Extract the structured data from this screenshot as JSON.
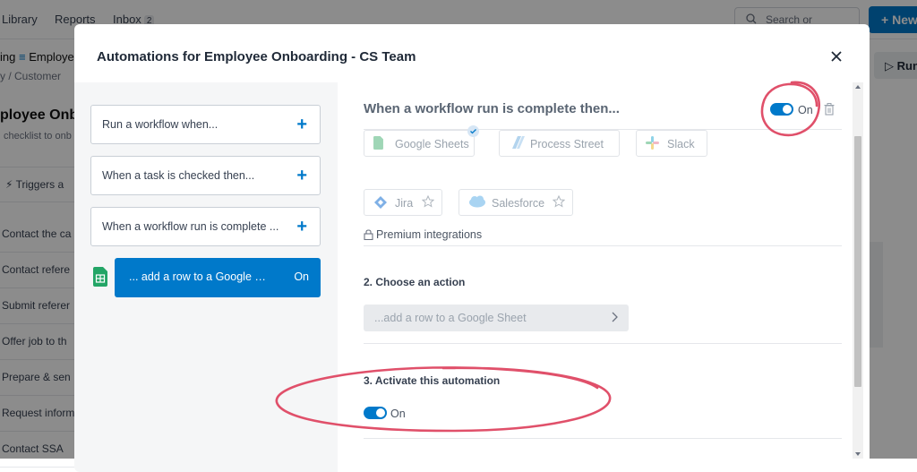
{
  "background": {
    "nav": {
      "library": "Library",
      "reports": "Reports",
      "inbox": "Inbox",
      "inbox_count": "2"
    },
    "search_placeholder": "Search or CTRL+K",
    "new_button": "New",
    "breadcrumb_top": "ing",
    "breadcrumb_top_2": "Employe",
    "breadcrumb_sub": "y  /  Customer",
    "run_button": "Run",
    "workflow_title": "ployee Onbo",
    "workflow_sub": "checklist to onb",
    "triggers_label": "Triggers a",
    "tasks": [
      "Contact the ca",
      "Contact refere",
      "Submit referer",
      "Offer job to th",
      "Prepare & sen",
      "Request inform",
      "Contact SSA"
    ]
  },
  "modal": {
    "title": "Automations for Employee Onboarding - CS Team",
    "triggers": [
      {
        "label": "Run a workflow when..."
      },
      {
        "label": "When a task is checked then..."
      },
      {
        "label": "When a workflow run is complete ..."
      }
    ],
    "active_automation": {
      "label": "... add a row to a Google She...",
      "status": "On"
    },
    "section_title": "When a workflow run is complete then...",
    "section_toggle_label": "On",
    "integrations": [
      {
        "name": "Google Sheets",
        "selected": true
      },
      {
        "name": "Process Street"
      },
      {
        "name": "Slack"
      }
    ],
    "premium_label": "Premium integrations",
    "premium_integrations": [
      {
        "name": "Jira"
      },
      {
        "name": "Salesforce"
      }
    ],
    "step2_title": "2. Choose an action",
    "action_value": "...add a row to a Google Sheet",
    "step3_title": "3. Activate this automation",
    "activate_toggle_label": "On"
  },
  "colors": {
    "accent": "#0079ca",
    "annotation": "#e0506a"
  }
}
